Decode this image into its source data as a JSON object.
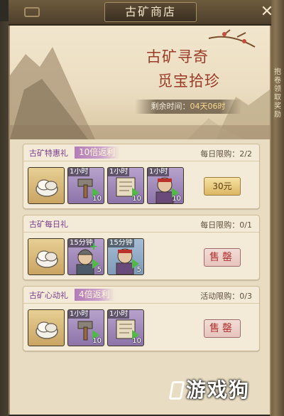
{
  "window": {
    "title": "古矿商店",
    "close_symbol": "✕"
  },
  "side_text": "抱\n卷\n领\n取\n奖\n励",
  "banner": {
    "slogan_line1": "古矿寻奇",
    "slogan_line2": "觅宝拾珍",
    "timer_label": "剩余时间：",
    "timer_value": "04天06时"
  },
  "sections": [
    {
      "title": "古矿特惠礼",
      "tag": "10倍返利",
      "limit": "每日限购：2/2",
      "items": [
        {
          "icon": "white-ore-icon",
          "tier": "gold",
          "time": "",
          "count": ""
        },
        {
          "icon": "hammer-speedup-icon",
          "tier": "purple",
          "time": "1小时",
          "count": "10"
        },
        {
          "icon": "scroll-speedup-icon",
          "tier": "purple",
          "time": "1小时",
          "count": "10"
        },
        {
          "icon": "soldier-speedup-icon",
          "tier": "purple",
          "time": "1小时",
          "count": "10"
        }
      ],
      "action": {
        "type": "price",
        "label": "30元"
      }
    },
    {
      "title": "古矿每日礼",
      "tag": "",
      "limit": "每日限购：0/1",
      "items": [
        {
          "icon": "white-ore-icon",
          "tier": "gold",
          "time": "",
          "count": ""
        },
        {
          "icon": "soldier-heal-icon",
          "tier": "purple",
          "time": "15分钟",
          "count": "5"
        },
        {
          "icon": "soldier-speedup-icon",
          "tier": "blue",
          "time": "15分钟",
          "count": "5"
        }
      ],
      "action": {
        "type": "sold",
        "label": "售罄"
      }
    },
    {
      "title": "古矿心动礼",
      "tag": "4倍返利",
      "limit": "活动限购：0/3",
      "items": [
        {
          "icon": "white-ore-icon",
          "tier": "gold",
          "time": "",
          "count": ""
        },
        {
          "icon": "hammer-speedup-icon",
          "tier": "purple",
          "time": "1小时",
          "count": "10"
        },
        {
          "icon": "scroll-speedup-icon",
          "tier": "purple",
          "time": "1小时",
          "count": "10"
        }
      ],
      "action": {
        "type": "sold",
        "label": "售罄"
      }
    }
  ],
  "watermark": "游戏狗",
  "colors": {
    "accent": "#9a3b28",
    "tag_purple": "#b27cb8",
    "price_gold": "#dcb763",
    "sold_red": "#b02f2f"
  }
}
